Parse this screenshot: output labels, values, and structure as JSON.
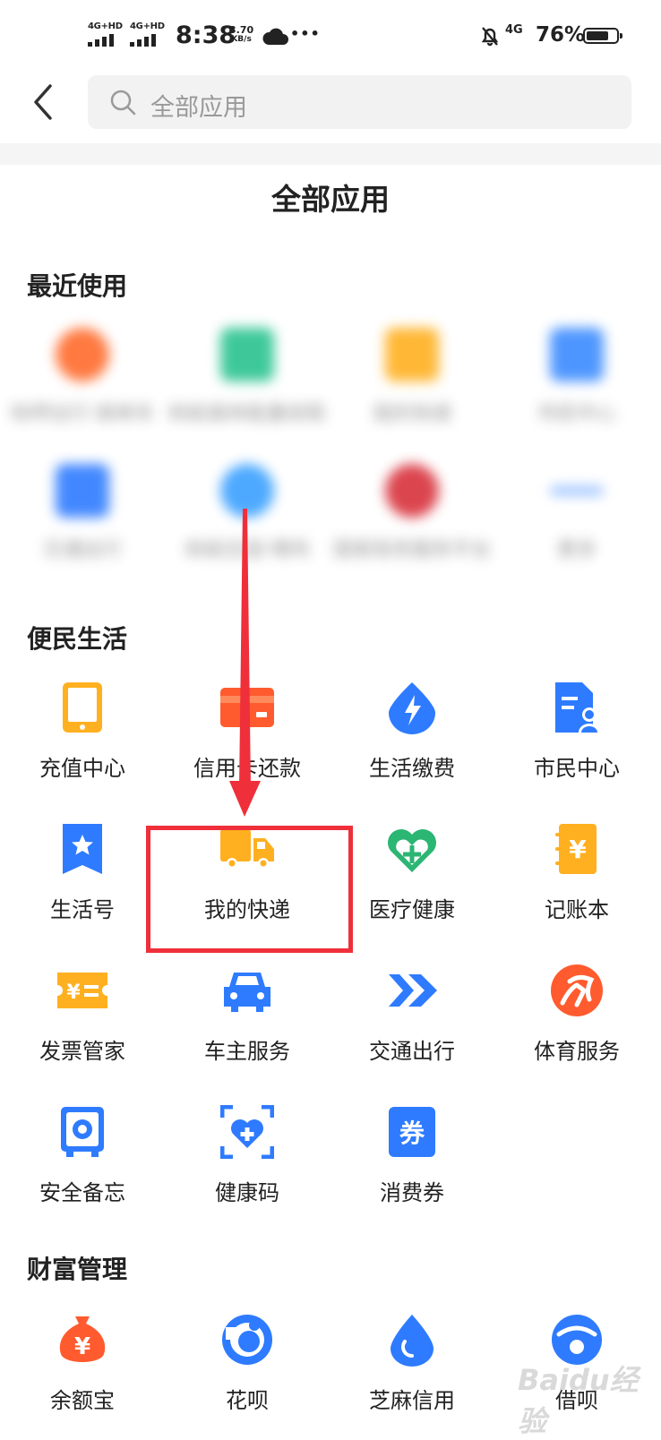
{
  "status_bar": {
    "signal1": "4G+HD",
    "signal2": "4G+HD",
    "time": "8:38",
    "speed_value": "3.70",
    "speed_unit": "KB/s",
    "dots": "•••",
    "net": "4G",
    "battery": "76%",
    "battery_level": 0.76
  },
  "search": {
    "placeholder": "全部应用"
  },
  "page_title": "全部应用",
  "sections": {
    "recent": {
      "title": "最近使用",
      "items": [
        {
          "label": "哈啰出行·骑单车",
          "color": "#ff6b2c"
        },
        {
          "label": "蚂蚁森林能量收取",
          "color": "#2ac38f"
        },
        {
          "label": "我的快递",
          "color": "#ffb020"
        },
        {
          "label": "市民中心",
          "color": "#3b8bff"
        },
        {
          "label": "交通出行",
          "color": "#2e7bff"
        },
        {
          "label": "蚂蚁庄园·喂鸡",
          "color": "#3aa0ff"
        },
        {
          "label": "国家政务服务平台",
          "color": "#d8313b"
        },
        {
          "label": "更多",
          "color": "#8bb8ff"
        }
      ]
    },
    "life": {
      "title": "便民生活",
      "items": [
        {
          "label": "充值中心",
          "icon": "phone-recharge-icon"
        },
        {
          "label": "信用卡还款",
          "icon": "credit-card-icon"
        },
        {
          "label": "生活缴费",
          "icon": "utility-bill-icon"
        },
        {
          "label": "市民中心",
          "icon": "citizen-center-icon"
        },
        {
          "label": "生活号",
          "icon": "life-account-icon"
        },
        {
          "label": "我的快递",
          "icon": "delivery-truck-icon"
        },
        {
          "label": "医疗健康",
          "icon": "medical-health-icon"
        },
        {
          "label": "记账本",
          "icon": "ledger-book-icon"
        },
        {
          "label": "发票管家",
          "icon": "invoice-icon"
        },
        {
          "label": "车主服务",
          "icon": "car-icon"
        },
        {
          "label": "交通出行",
          "icon": "transport-arrows-icon"
        },
        {
          "label": "体育服务",
          "icon": "sports-icon"
        },
        {
          "label": "安全备忘",
          "icon": "safe-box-icon"
        },
        {
          "label": "健康码",
          "icon": "health-code-icon"
        },
        {
          "label": "消费券",
          "icon": "coupon-icon"
        }
      ]
    },
    "wealth": {
      "title": "财富管理",
      "items": [
        {
          "label": "余额宝",
          "icon": "yuebao-icon"
        },
        {
          "label": "花呗",
          "icon": "huabei-icon"
        },
        {
          "label": "芝麻信用",
          "icon": "sesame-credit-icon"
        },
        {
          "label": "借呗",
          "icon": "jiebei-icon"
        }
      ]
    }
  },
  "icon_glyphs": {
    "yen": "¥",
    "coupon": "券"
  },
  "watermark": {
    "text": "Baidu经验"
  },
  "colors": {
    "blue": "#2e7bff",
    "orange": "#ffb020",
    "red_orange": "#ff5b2e",
    "green": "#2bb673",
    "highlight": "#ef2f3a"
  }
}
